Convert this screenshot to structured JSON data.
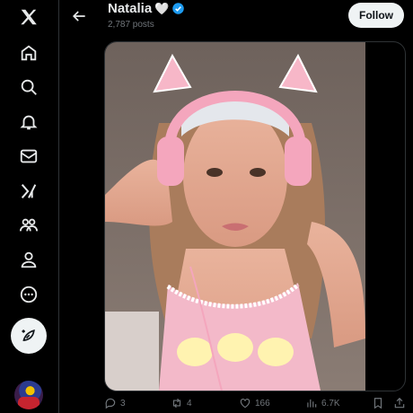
{
  "profile": {
    "name": "Natalia",
    "name_emoji": "🤍",
    "posts": "2,787 posts",
    "follow_label": "Follow"
  },
  "nav": {
    "items": [
      "x-logo-icon",
      "home-icon",
      "explore-icon",
      "notifications-icon",
      "messages-icon",
      "grok-icon",
      "communities-icon",
      "profile-icon",
      "more-icon"
    ],
    "compose": "compose-post-icon"
  },
  "actions": {
    "replies": "3",
    "reposts": "4",
    "likes": "166",
    "views": "6.7K"
  },
  "colors": {
    "background": "#000000",
    "verified": "#1d9bf0",
    "muted": "#71767b",
    "button_bg": "#eff3f4"
  }
}
